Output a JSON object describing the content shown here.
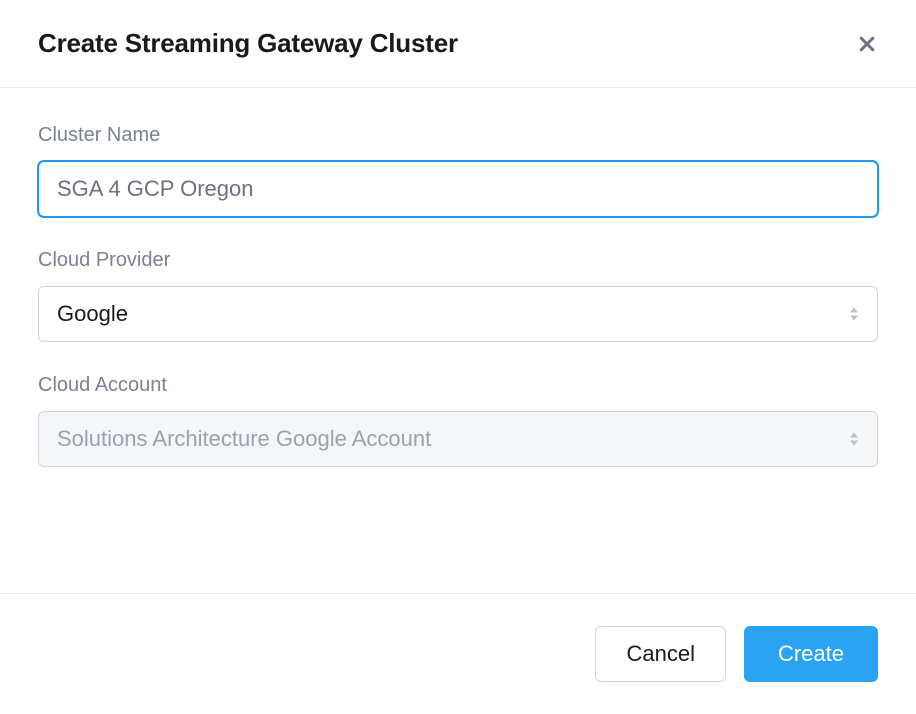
{
  "dialog": {
    "title": "Create Streaming Gateway Cluster"
  },
  "form": {
    "cluster_name": {
      "label": "Cluster Name",
      "value": "SGA 4 GCP Oregon"
    },
    "cloud_provider": {
      "label": "Cloud Provider",
      "value": "Google"
    },
    "cloud_account": {
      "label": "Cloud Account",
      "value": "Solutions Architecture Google Account"
    }
  },
  "footer": {
    "cancel_label": "Cancel",
    "create_label": "Create"
  }
}
